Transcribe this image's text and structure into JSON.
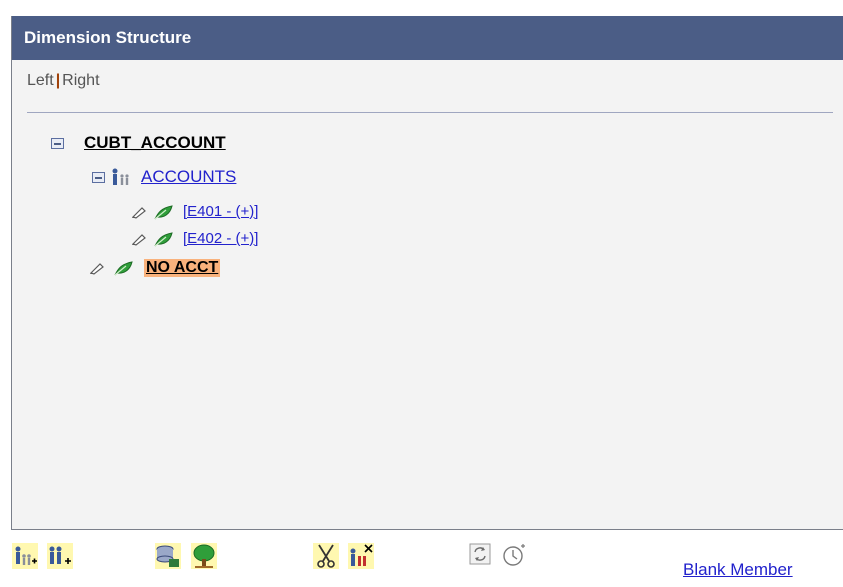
{
  "panel": {
    "title": "Dimension Structure",
    "nav": {
      "left": "Left",
      "separator": "|",
      "right": "Right"
    }
  },
  "tree": {
    "root": {
      "label": "CUBT_ACCOUNT",
      "expanded": true
    },
    "group": {
      "label": "ACCOUNTS",
      "expanded": true
    },
    "members": [
      {
        "label": "[E401 - (+)]"
      },
      {
        "label": "[E402 - (+)]"
      }
    ],
    "selected": {
      "label": "NO ACCT",
      "highlight_color": "#f9b27c"
    }
  },
  "toolbar": {
    "icons": [
      "insert-child-icon",
      "insert-sibling-icon",
      "insert-from-database-icon",
      "tree-icon",
      "cut-icon",
      "delete-node-icon",
      "refresh-icon",
      "effective-date-icon"
    ],
    "blank_member_link": "Blank Member"
  },
  "colors": {
    "header_bg": "#4b5d86",
    "panel_bg": "#f3f3f3",
    "link": "#2222cc",
    "selected_bg": "#f9b27c"
  }
}
